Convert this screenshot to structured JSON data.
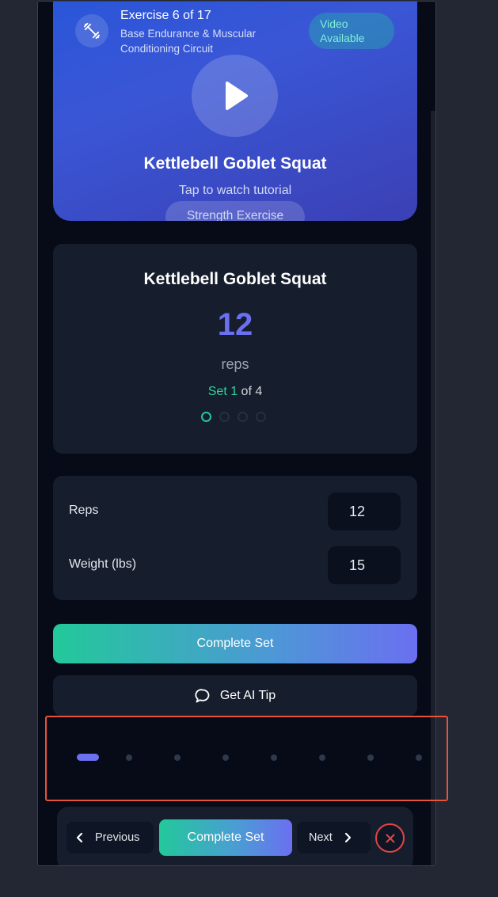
{
  "colors": {
    "page_bg": "#222733",
    "app_bg": "#060b17",
    "card_bg": "#161e2d",
    "accent_green": "#2fd39f",
    "accent_purple": "#6b6ff0",
    "close_red": "#e04545",
    "highlight_border": "#e5533b"
  },
  "hero": {
    "icon": "dumbbell-icon",
    "exercise_counter": "Exercise 6 of 17",
    "circuit_name": "Base Endurance & Muscular Conditioning Circuit",
    "video_badge": "Video Available",
    "play_icon": "play-icon",
    "title": "Kettlebell Goblet Squat",
    "tap_hint": "Tap to watch tutorial",
    "category_tag": "Strength Exercise"
  },
  "exercise_card": {
    "title": "Kettlebell Goblet Squat",
    "target_reps": "12",
    "unit": "reps",
    "set_prefix": "Set 1",
    "set_suffix": " of 4",
    "current_set": 1,
    "total_sets": 4
  },
  "inputs": {
    "reps_label": "Reps",
    "reps_value": "12",
    "weight_label": "Weight (lbs)",
    "weight_value": "15"
  },
  "actions": {
    "complete_set": "Complete Set",
    "ai_tip": "Get AI Tip",
    "ai_tip_icon": "chat-bubble-icon"
  },
  "exercise_pager": {
    "active_index": 0,
    "visible_dots": 8
  },
  "bottom_nav": {
    "previous": "Previous",
    "previous_icon": "chevron-left-icon",
    "complete_set": "Complete Set",
    "next": "Next",
    "next_icon": "chevron-right-icon",
    "close_icon": "close-icon"
  }
}
